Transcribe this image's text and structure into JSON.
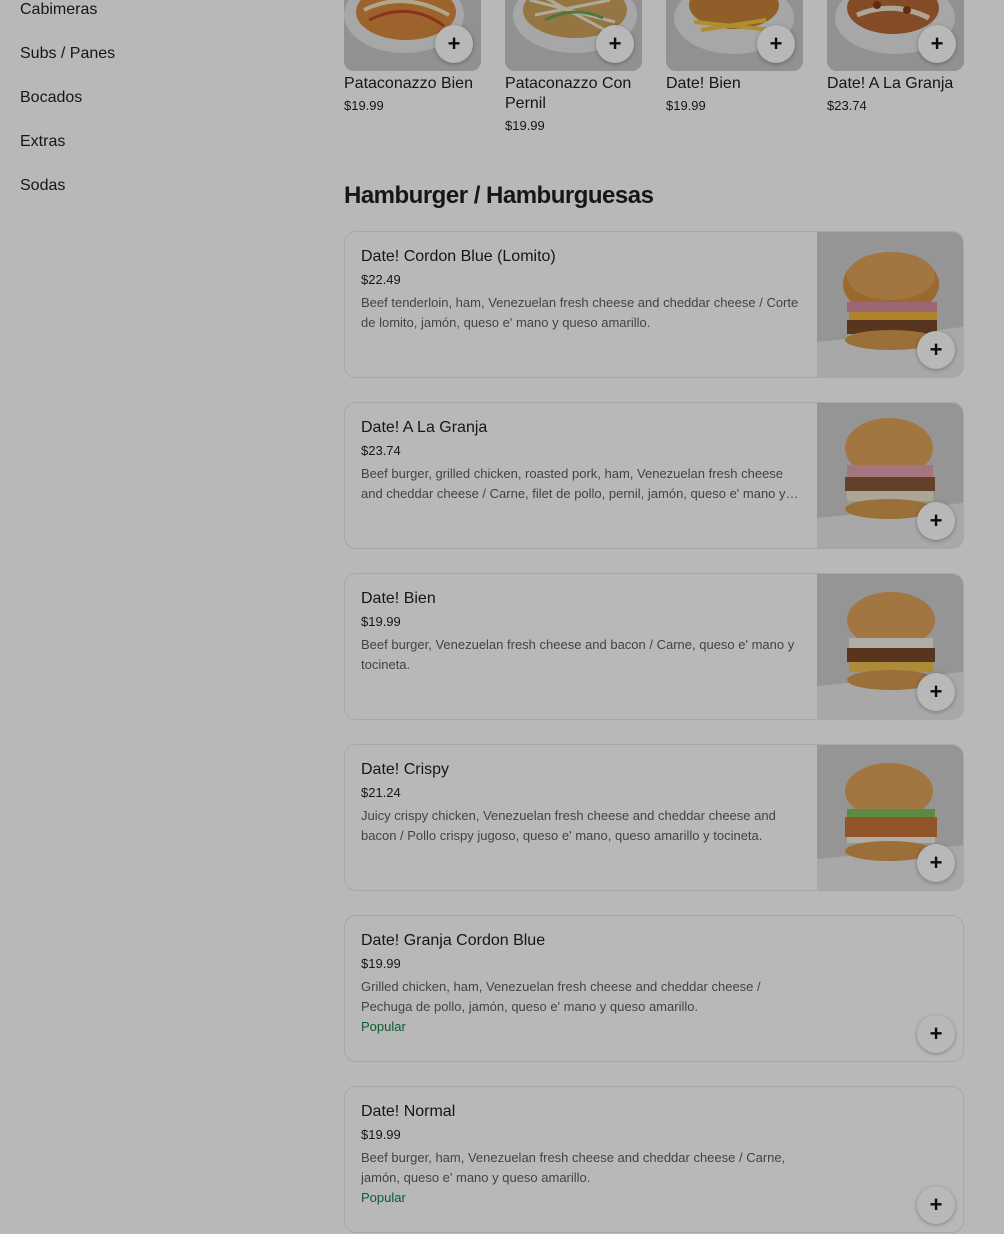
{
  "sidebar": {
    "items": [
      {
        "label": "Cabimeras"
      },
      {
        "label": "Subs / Panes"
      },
      {
        "label": "Bocados"
      },
      {
        "label": "Extras"
      },
      {
        "label": "Sodas"
      }
    ]
  },
  "carousel": [
    {
      "title": "Pataconazzo Bien",
      "price": "$19.99"
    },
    {
      "title": "Pataconazzo Con Pernil",
      "price": "$19.99"
    },
    {
      "title": "Date! Bien",
      "price": "$19.99"
    },
    {
      "title": "Date! A La Granja",
      "price": "$23.74"
    }
  ],
  "section": {
    "title": "Hamburger / Hamburguesas"
  },
  "items": [
    {
      "name": "Date! Cordon Blue (Lomito)",
      "price": "$22.49",
      "desc": "Beef tenderloin, ham, Venezuelan fresh cheese and cheddar cheese / Corte de lomito, jamón, queso e' mano y queso amarillo.",
      "tag": ""
    },
    {
      "name": "Date! A La Granja",
      "price": "$23.74",
      "desc": "Beef burger, grilled chicken, roasted pork, ham, Venezuelan fresh cheese and cheddar cheese / Carne, filet de pollo, pernil, jamón, queso e' mano y queso amarillo.",
      "tag": ""
    },
    {
      "name": "Date! Bien",
      "price": "$19.99",
      "desc": "Beef burger, Venezuelan fresh cheese and bacon / Carne, queso e' mano y tocineta.",
      "tag": ""
    },
    {
      "name": "Date! Crispy",
      "price": "$21.24",
      "desc": "Juicy crispy chicken, Venezuelan fresh cheese and cheddar cheese and bacon / Pollo crispy jugoso, queso e' mano, queso amarillo y tocineta.",
      "tag": ""
    },
    {
      "name": "Date! Granja Cordon Blue",
      "price": "$19.99",
      "desc": "Grilled chicken, ham, Venezuelan fresh cheese and cheddar cheese / Pechuga de pollo, jamón, queso e' mano y queso amarillo.",
      "tag": "Popular"
    },
    {
      "name": "Date! Normal",
      "price": "$19.99",
      "desc": "Beef burger, ham, Venezuelan fresh cheese and cheddar cheese / Carne, jamón, queso e' mano y queso amarillo.",
      "tag": "Popular"
    }
  ],
  "icons": {
    "add": "plus-icon"
  },
  "colors": {
    "popular": "#0e8345",
    "overlay": "rgba(0,0,0,0.28)"
  },
  "plus_glyph": "+"
}
